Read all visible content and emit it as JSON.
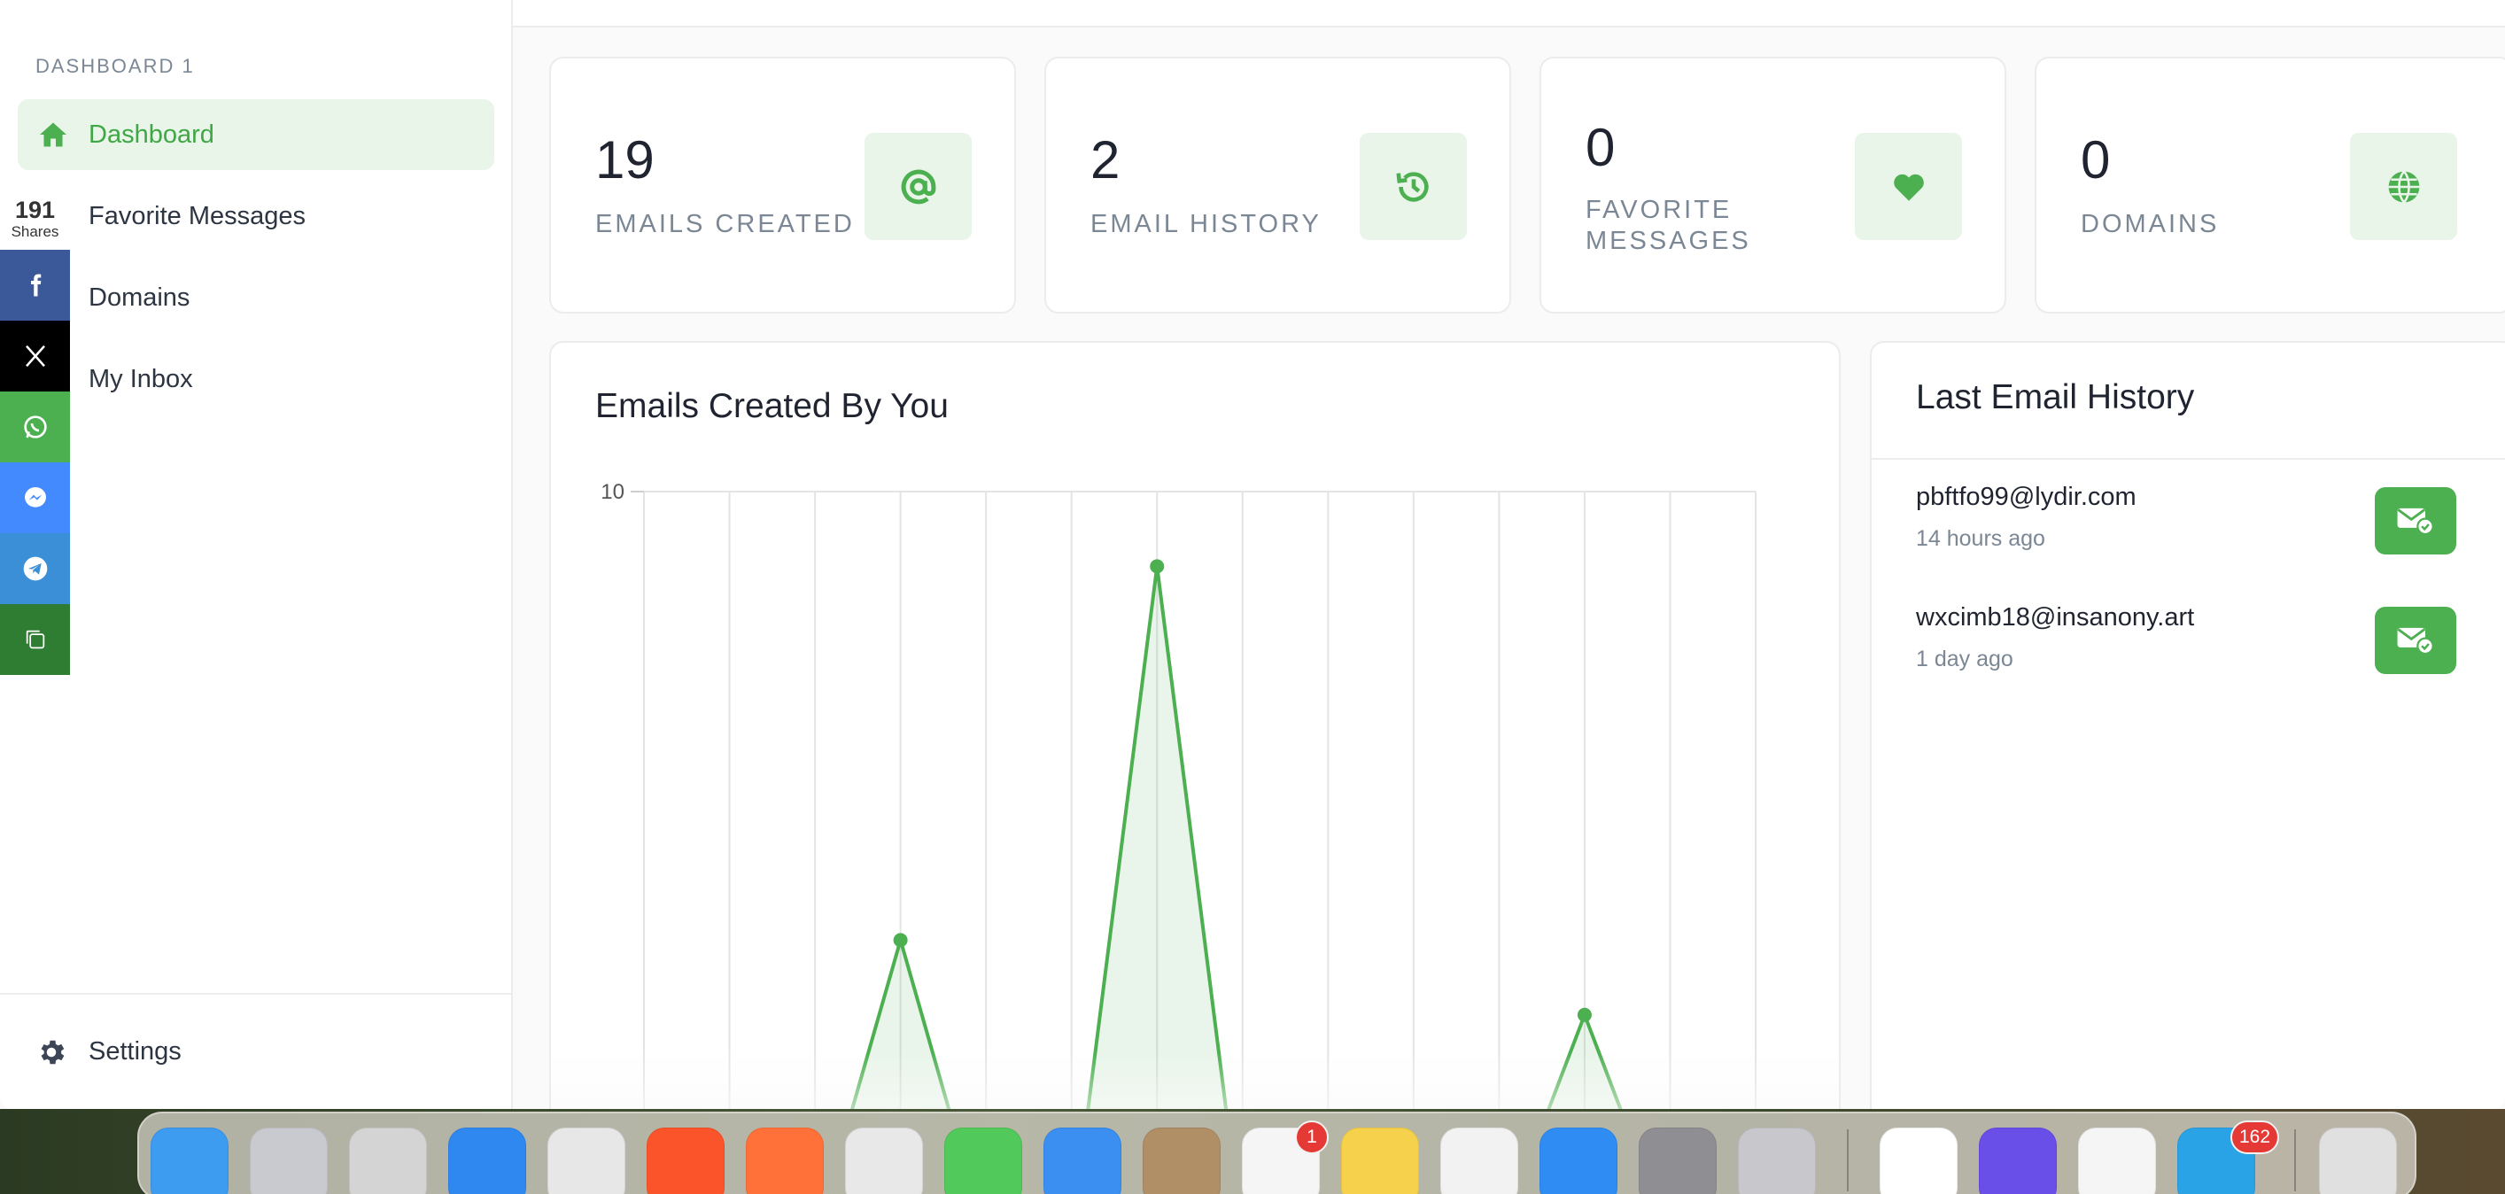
{
  "sidebar": {
    "section_title": "DASHBOARD 1",
    "items": [
      {
        "label": "Dashboard"
      },
      {
        "label": "Favorite Messages"
      },
      {
        "label": "Domains"
      },
      {
        "label": "My Inbox"
      }
    ],
    "settings_label": "Settings"
  },
  "share_bar": {
    "count": "191",
    "count_label": "Shares",
    "buttons": [
      {
        "icon": "facebook-icon",
        "color": "#3b5998"
      },
      {
        "icon": "x-icon",
        "color": "#000000"
      },
      {
        "icon": "whatsapp-icon",
        "color": "#4caf50"
      },
      {
        "icon": "messenger-icon",
        "color": "#448aff"
      },
      {
        "icon": "telegram-icon",
        "color": "#3b8fd6"
      },
      {
        "icon": "copy-icon",
        "color": "#2e7d32"
      }
    ]
  },
  "stats": [
    {
      "value": "19",
      "label": "EMAILS CREATED",
      "icon": "at-icon"
    },
    {
      "value": "2",
      "label": "EMAIL HISTORY",
      "icon": "history-icon"
    },
    {
      "value": "0",
      "label_line1": "FAVORITE",
      "label_line2": "MESSAGES",
      "icon": "heart-icon"
    },
    {
      "value": "0",
      "label": "DOMAINS",
      "icon": "globe-icon"
    }
  ],
  "chart_title": "Emails Created By You",
  "chart_data": {
    "type": "area",
    "title": "Emails Created By You",
    "xlabel": "",
    "ylabel": "",
    "y_tick_labels": [
      "10"
    ],
    "ylim": [
      0,
      10
    ],
    "x_count": 14,
    "values": [
      0,
      0,
      0,
      4,
      0,
      0,
      9,
      0,
      0,
      0,
      0,
      3,
      0,
      0
    ],
    "grid": true,
    "color": "#4caf50"
  },
  "history": {
    "title": "Last Email History",
    "items": [
      {
        "email": "pbftfo99@lydir.com",
        "time": "14 hours ago"
      },
      {
        "email": "wxcimb18@insanony.art",
        "time": "1 day ago"
      }
    ]
  },
  "dock": {
    "apps": [
      {
        "name": "finder-icon",
        "color": "#3d9bf0"
      },
      {
        "name": "launchpad-icon",
        "color": "#c9c9d0"
      },
      {
        "name": "screenshot-icon",
        "color": "#d4d4d4"
      },
      {
        "name": "safari-icon",
        "color": "#2f88f0"
      },
      {
        "name": "chrome-icon",
        "color": "#e7e7e7"
      },
      {
        "name": "brave-icon",
        "color": "#fb542b"
      },
      {
        "name": "firefox-icon",
        "color": "#ff7139"
      },
      {
        "name": "opera-icon",
        "color": "#e8e8e8"
      },
      {
        "name": "messages-icon",
        "color": "#52c95b"
      },
      {
        "name": "mail-icon",
        "color": "#3a8ff0"
      },
      {
        "name": "contacts-icon",
        "color": "#b08e66"
      },
      {
        "name": "reminders-icon",
        "color": "#f5f5f5",
        "badge": "1"
      },
      {
        "name": "notes-icon",
        "color": "#f6d24c"
      },
      {
        "name": "textedit-icon",
        "color": "#f2f2f2"
      },
      {
        "name": "app-store-icon",
        "color": "#2f8cf3"
      },
      {
        "name": "system-settings-icon",
        "color": "#8e8e93"
      },
      {
        "name": "iphone-mirroring-icon",
        "color": "#c7c7cc"
      },
      {
        "name": "notion-icon",
        "color": "#ffffff"
      },
      {
        "name": "firefox-dev-icon",
        "color": "#6a4ee8"
      },
      {
        "name": "tasks-icon",
        "color": "#f5f5f5"
      },
      {
        "name": "telegram-app-icon",
        "color": "#2aa3e6",
        "badge": "162"
      },
      {
        "name": "trash-icon",
        "color": "#e0e0e0"
      }
    ]
  }
}
